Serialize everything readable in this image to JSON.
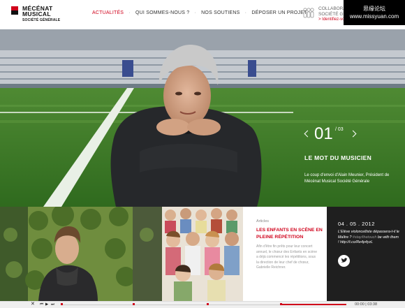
{
  "brand": {
    "line1": "MÉCÉNAT",
    "line2": "MUSICAL",
    "sub": "SOCIÉTÉ GÉNÉRALE"
  },
  "nav": {
    "items": [
      {
        "label": "ACTUALITÉS",
        "active": true
      },
      {
        "label": "QUI SOMMES-NOUS ?",
        "active": false
      },
      {
        "label": "NOS SOUTIENS",
        "active": false
      },
      {
        "label": "DÉPOSER UN PROJET",
        "active": false
      }
    ]
  },
  "collab": {
    "line1": "COLLABORATEI",
    "line2": "SOCIÉTÉ GÉNÉ",
    "link": "> Identifiez-vo"
  },
  "watermark": {
    "line1": "思缘论坛",
    "line2": "www.missyuan.com"
  },
  "hero": {
    "slide_current": "01",
    "slide_total": "/ 03",
    "title": "LE MOT DU MUSICIEN",
    "description": "Le coup d'envoi d'Alain Meunier, Président de Mécénat Musical Société Générale"
  },
  "article": {
    "tag": "Articles",
    "title": "LES ENFANTS EN SCÈNE EN PLEINE RÉPÉTITION",
    "text": "Afin d'être fin prêts pour leur concert annuel, le chœur des Enfants en scène a déjà commencé les répétitions, sous la direction de leur chef de chœur, Gabrielle Reichner."
  },
  "tweet": {
    "date": "04 . 05 . 2012",
    "text_a": "L'Elève violoncelliste dépassera-t-il le Maître ? ",
    "text_hl": "#stay/thetouch",
    "text_b": " be with them ! http://t.co/Re4p4yzL"
  },
  "player": {
    "time_current": "00:00",
    "time_total": "03:38",
    "progress": 0.77
  },
  "colors": {
    "accent": "#d0021b",
    "tweet_bg": "#1f1f1f"
  }
}
